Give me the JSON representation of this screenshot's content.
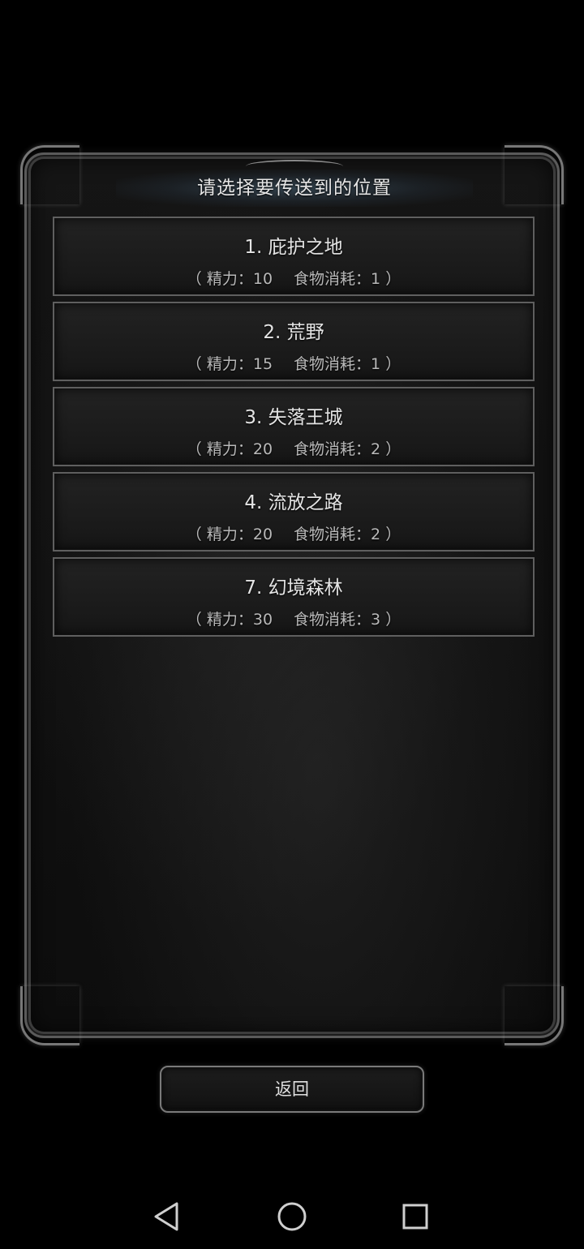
{
  "dialog": {
    "title": "请选择要传送到的位置"
  },
  "locations": [
    {
      "name": "1. 庇护之地",
      "open": "（",
      "stamina": "精力：10",
      "food": "食物消耗：1",
      "close": "）"
    },
    {
      "name": "2. 荒野",
      "open": "（",
      "stamina": "精力：15",
      "food": "食物消耗：1",
      "close": "）"
    },
    {
      "name": "3. 失落王城",
      "open": "（",
      "stamina": "精力：20",
      "food": "食物消耗：2",
      "close": "）"
    },
    {
      "name": "4. 流放之路",
      "open": "（",
      "stamina": "精力：20",
      "food": "食物消耗：2",
      "close": "）"
    },
    {
      "name": "7. 幻境森林",
      "open": "（",
      "stamina": "精力：30",
      "food": "食物消耗：3",
      "close": "）"
    }
  ],
  "back_button": {
    "label": "返回"
  },
  "navbar": {
    "icons": [
      "back-triangle-icon",
      "home-circle-icon",
      "recent-square-icon"
    ]
  },
  "colors": {
    "background": "#000000",
    "panel": "#151515",
    "border": "#5a5a5a",
    "title_glow": "#3c5060",
    "text": "#e4e4e4"
  }
}
